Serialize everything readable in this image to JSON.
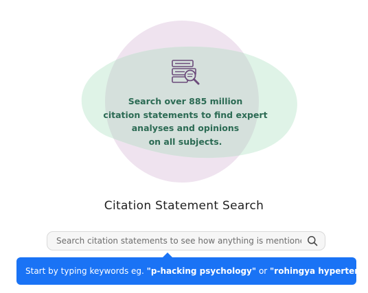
{
  "hero": {
    "line1": "Search over 885 million",
    "line2": "citation statements to find expert",
    "line3": "analyses and opinions",
    "line4": "on all subjects."
  },
  "title": "Citation Statement Search",
  "search": {
    "placeholder": "Search citation statements to see how anything is mentioned",
    "value": ""
  },
  "tooltip": {
    "prefix": "Start by typing keywords eg. ",
    "example1": "\"p-hacking psychology\"",
    "connector": " or ",
    "example2": "\"rohingya hypertension\""
  },
  "colors": {
    "accent": "#1a73f5",
    "hero_text": "#2b6a53",
    "blob_pink": "#efe3ef",
    "blob_green": "#dff3e7",
    "blob_overlap": "#d5e0dc",
    "illustration": "#6b4a7a"
  },
  "icons": {
    "illustration": "documents-magnifier-icon",
    "search": "search-icon"
  }
}
